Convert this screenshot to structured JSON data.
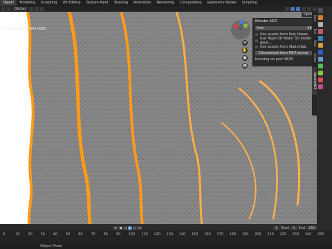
{
  "topbar": {
    "workspaces": [
      "Object",
      "Modeling",
      "Sculpting",
      "UV Editing",
      "Texture Paint",
      "Shading",
      "Animation",
      "Rendering",
      "Compositing",
      "Geometry Nodes",
      "Scripting"
    ],
    "active": "Object"
  },
  "header": {
    "transform_orientation": "Global"
  },
  "viewport": {
    "overlay_text": "Printable Mode (445,000f)",
    "options_label": "Options"
  },
  "mcp_panel": {
    "title": "Blender MCP",
    "port_label": "Port",
    "port_value": "9876",
    "options": [
      "Use assets from Poly Haven",
      "Use Hyper3D Rodin 3D model gene...",
      "Use assets from Sketchfab"
    ],
    "button_label": "Disconnect from MCP server",
    "status": "Running on port 9876"
  },
  "sidebar_tabs": [
    "Item",
    "Tool",
    "View",
    "Create",
    "BlenderMCP"
  ],
  "sidebar_active": "BlenderMCP",
  "timeline": {
    "start_label": "Start",
    "start_value": "1",
    "end_label": "End",
    "end_value": "250",
    "current_frame": "1",
    "ruler": [
      "0",
      "10",
      "20",
      "30",
      "40",
      "50",
      "60",
      "70",
      "80",
      "90",
      "100",
      "110",
      "120",
      "130",
      "140",
      "150",
      "160",
      "170",
      "180",
      "190",
      "200",
      "210",
      "220",
      "230",
      "240",
      "250"
    ]
  },
  "statusbar": {
    "text": "Object Mode"
  },
  "colors": {
    "accent": "#4772b3",
    "mesh_orange": "#ff9a1a",
    "viewport_gray": "#7c7c7c"
  }
}
